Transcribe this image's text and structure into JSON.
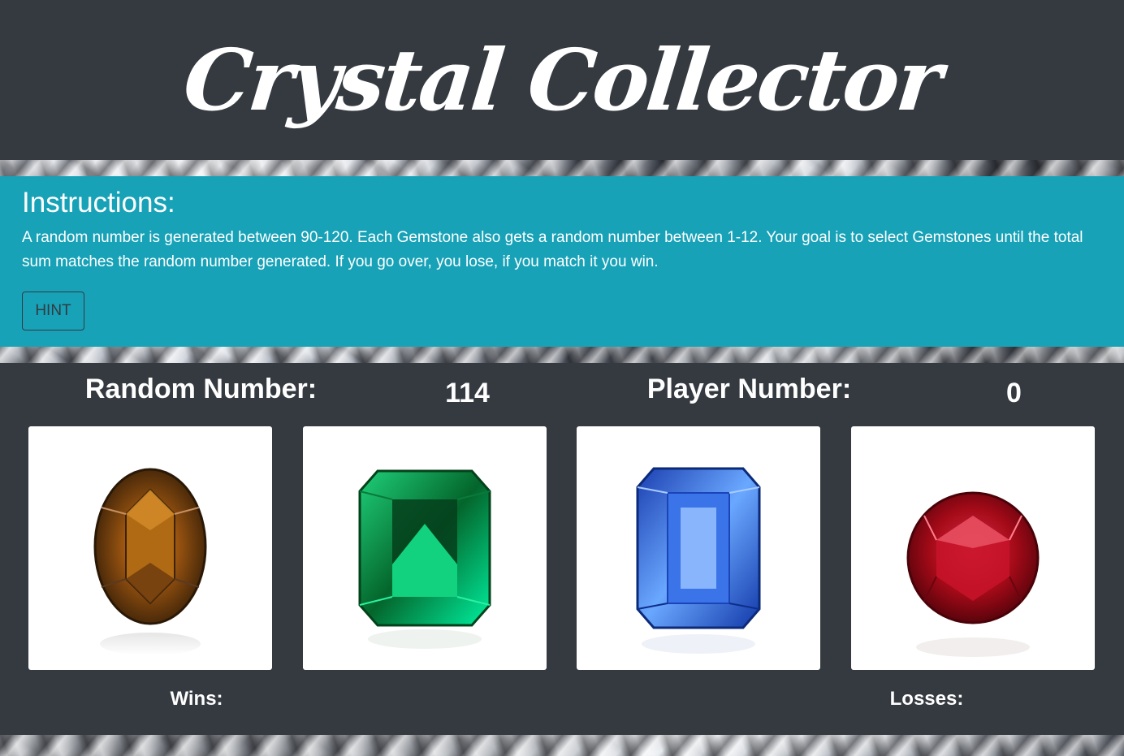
{
  "header": {
    "title": "Crystal Collector"
  },
  "instructions": {
    "heading": "Instructions:",
    "text": "A random number is generated between 90-120. Each Gemstone also gets a random number between 1-12. Your goal is to select Gemstones until the total sum matches the random number generated. If you go over, you lose, if you match it you win.",
    "hint_label": "HINT"
  },
  "game": {
    "random_label": "Random Number:",
    "random_value": "114",
    "player_label": "Player Number:",
    "player_value": "0",
    "wins_label": "Wins:",
    "losses_label": "Losses:",
    "gems": [
      {
        "icon": "brown-oval-gem-icon",
        "color": "#8a4a12"
      },
      {
        "icon": "green-emerald-gem-icon",
        "color": "#0c8a3e"
      },
      {
        "icon": "blue-sapphire-gem-icon",
        "color": "#1f5fd6"
      },
      {
        "icon": "red-ruby-gem-icon",
        "color": "#b0101e"
      }
    ]
  },
  "colors": {
    "header_bg": "#343a40",
    "instructions_bg": "#17a2b8",
    "text": "#ffffff"
  }
}
